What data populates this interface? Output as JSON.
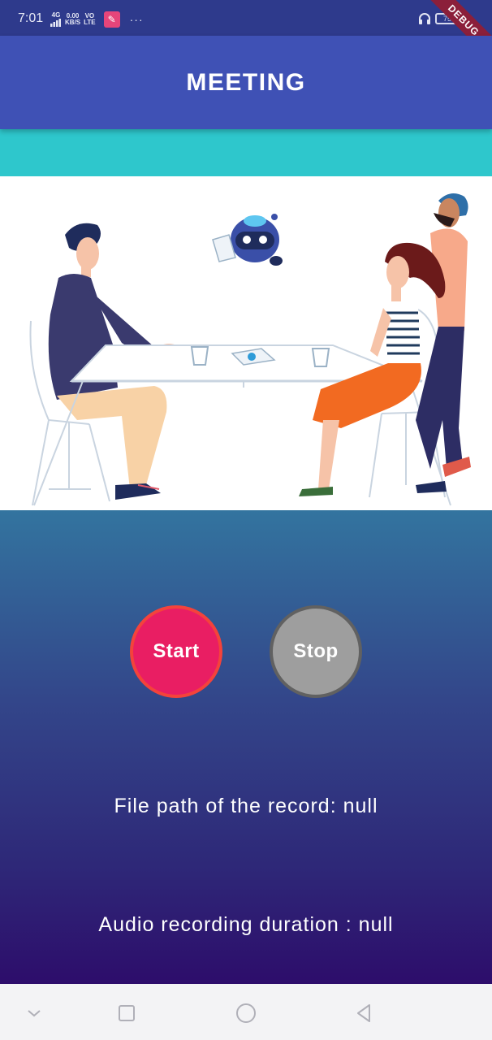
{
  "status_bar": {
    "time": "7:01",
    "network": "4G",
    "speed_value": "0.00",
    "speed_unit": "KB/S",
    "volte_top": "VO",
    "volte_bottom": "LTE",
    "more": "···",
    "battery": "75",
    "debug_label": "DEBUG"
  },
  "app_bar": {
    "title": "MEETING"
  },
  "controls": {
    "start_label": "Start",
    "stop_label": "Stop"
  },
  "info": {
    "file_path": "File path of the record: null",
    "duration": "Audio recording duration : null"
  },
  "colors": {
    "app_bar": "#3f51b5",
    "teal_band": "#2ec7cc",
    "start_button": "#e91e63",
    "stop_button": "#9e9e9e"
  },
  "icons": [
    "signal-icon",
    "headphones-icon",
    "battery-icon",
    "chevron-down-icon",
    "square-icon",
    "circle-icon",
    "back-triangle-icon"
  ]
}
